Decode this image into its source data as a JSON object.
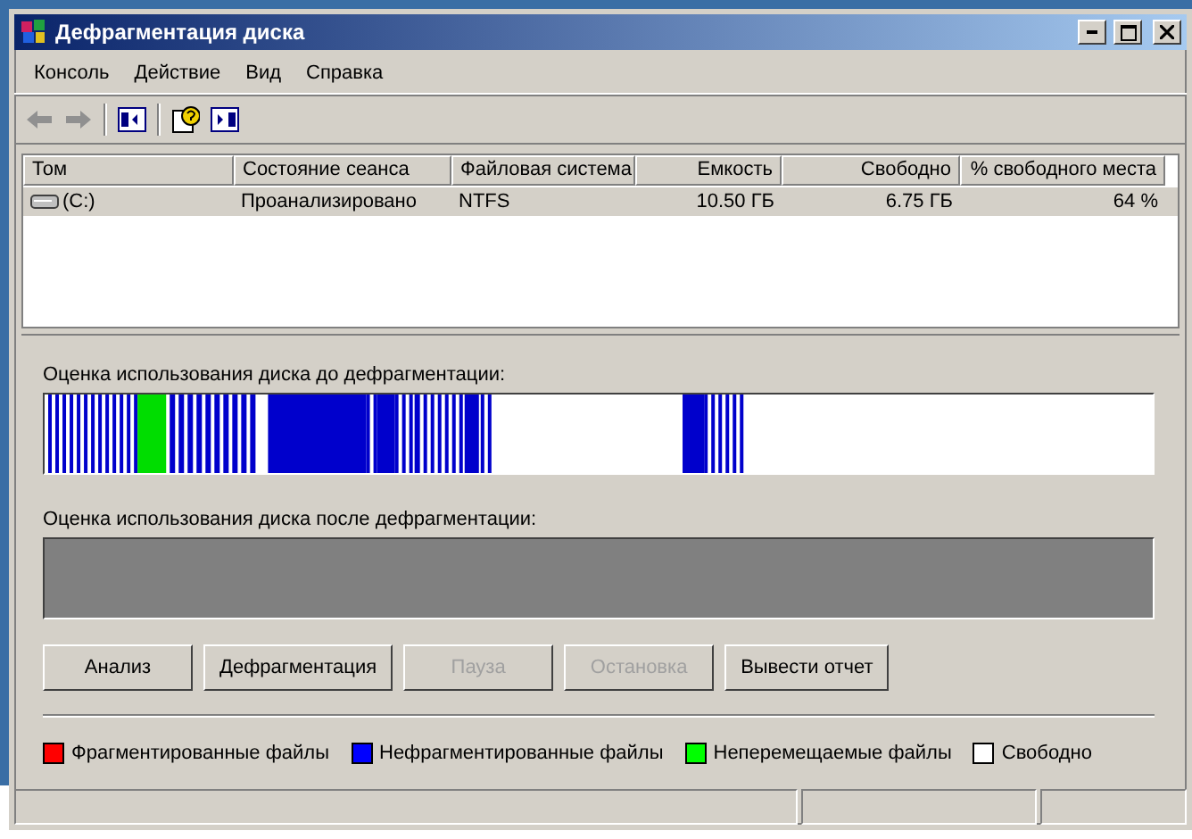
{
  "window": {
    "title": "Дефрагментация диска"
  },
  "menu": [
    "Консоль",
    "Действие",
    "Вид",
    "Справка"
  ],
  "table": {
    "columns": [
      "Том",
      "Состояние сеанса",
      "Файловая система",
      "Емкость",
      "Свободно",
      "% свободного места"
    ],
    "rows": [
      {
        "selected": true,
        "cells": [
          "(C:)",
          "Проанализировано",
          "NTFS",
          "10.50 ГБ",
          "6.75 ГБ",
          "64 %"
        ]
      }
    ]
  },
  "before": {
    "label": "Оценка использования диска до дефрагментации:"
  },
  "after": {
    "label": "Оценка использования диска после дефрагментации:"
  },
  "buttons": [
    {
      "label": "Анализ",
      "disabled": false
    },
    {
      "label": "Дефрагментация",
      "disabled": false
    },
    {
      "label": "Пауза",
      "disabled": true
    },
    {
      "label": "Остановка",
      "disabled": true
    },
    {
      "label": "Вывести отчет",
      "disabled": false
    }
  ],
  "legend": [
    {
      "label": "Фрагментированные файлы",
      "color": "#ff0000"
    },
    {
      "label": "Нефрагментированные файлы",
      "color": "#0000ff"
    },
    {
      "label": "Неперемещаемые файлы",
      "color": "#00ff00"
    },
    {
      "label": "Свободно",
      "color": "#ffffff"
    }
  ]
}
